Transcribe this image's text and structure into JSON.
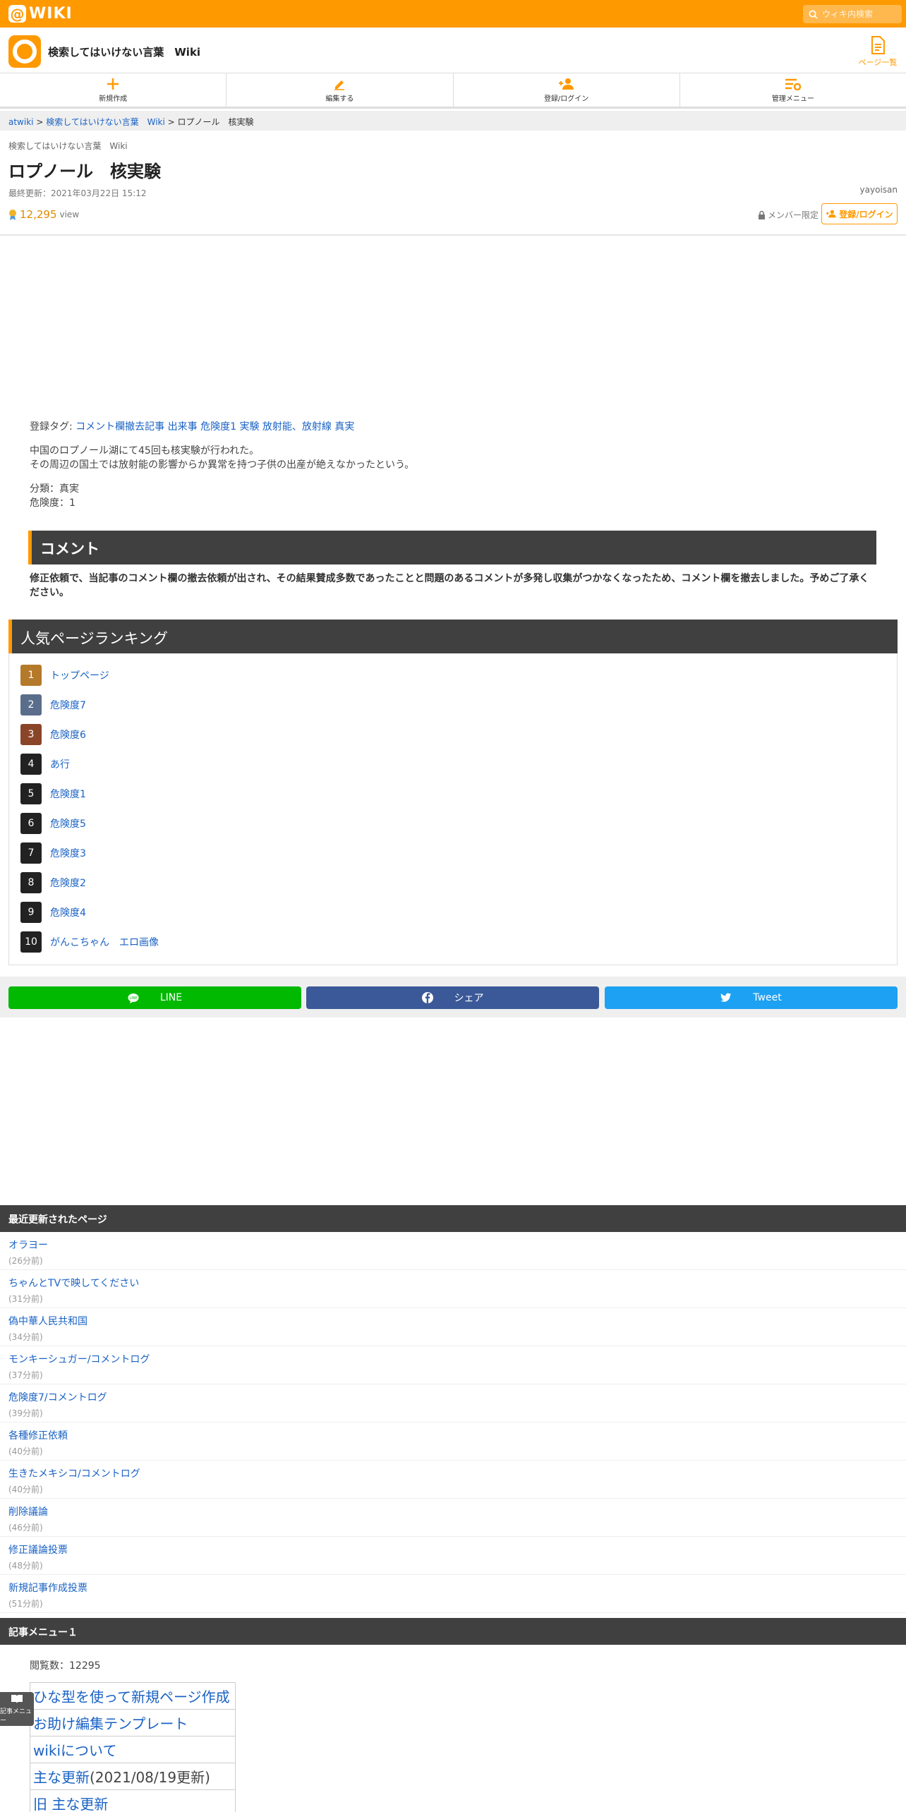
{
  "topbar": {
    "logo_text": "WIKI",
    "search_placeholder": "ウィキ内検索"
  },
  "site": {
    "title": "検索してはいけない言葉　Wiki",
    "page_list_label": "ページ一覧"
  },
  "nav": [
    {
      "label": "新規作成",
      "icon": "plus-icon"
    },
    {
      "label": "編集する",
      "icon": "pencil-icon"
    },
    {
      "label": "登録/ログイン",
      "icon": "add-user-icon"
    },
    {
      "label": "管理メニュー",
      "icon": "settings-list-icon"
    }
  ],
  "breadcrumb": {
    "home": "atwiki",
    "sep1": " > ",
    "wiki": "検索してはいけない言葉　Wiki",
    "sep2": " > ",
    "current": "ロプノール　核実験"
  },
  "page": {
    "subtitle": "検索してはいけない言葉　Wiki",
    "title": "ロプノール　核実験",
    "updated": "最終更新：2021年03月22日 15:12",
    "author": "yayoisan",
    "views_value": "12,295",
    "views_unit": "view",
    "member_only": "メンバー限定",
    "login_button": "登録/ログイン"
  },
  "content": {
    "tags_label": "登録タグ:",
    "tags": [
      "コメント欄撤去記事",
      "出来事",
      "危険度1",
      "実験",
      "放射能、放射線",
      "真実"
    ],
    "body_line1": "中国のロプノール湖にて45回も核実験が行われた。",
    "body_line2": "その周辺の国土では放射能の影響からか異常を持つ子供の出産が絶えなかったという。",
    "class_line": "分類：真実",
    "danger_line": "危険度：1",
    "comment_heading": "コメント",
    "comment_note": "修正依頼で、当記事のコメント欄の撤去依頼が出され、その結果賛成多数であったことと問題のあるコメントが多発し収集がつかなくなったため、コメント欄を撤去しました。予めご了承ください。"
  },
  "ranking": {
    "heading": "人気ページランキング",
    "items": [
      {
        "rank": "1",
        "title": "トップページ",
        "color": "#b5792a"
      },
      {
        "rank": "2",
        "title": "危険度7",
        "color": "#5a6e8c"
      },
      {
        "rank": "3",
        "title": "危険度6",
        "color": "#8a4528"
      },
      {
        "rank": "4",
        "title": "あ行",
        "color": "#222222"
      },
      {
        "rank": "5",
        "title": "危険度1",
        "color": "#222222"
      },
      {
        "rank": "6",
        "title": "危険度5",
        "color": "#222222"
      },
      {
        "rank": "7",
        "title": "危険度3",
        "color": "#222222"
      },
      {
        "rank": "8",
        "title": "危険度2",
        "color": "#222222"
      },
      {
        "rank": "9",
        "title": "危険度4",
        "color": "#222222"
      },
      {
        "rank": "10",
        "title": "がんこちゃん　エロ画像",
        "color": "#222222"
      }
    ]
  },
  "share": {
    "line": "LINE",
    "facebook": "シェア",
    "twitter": "Tweet"
  },
  "recent": {
    "heading": "最近更新されたページ",
    "items": [
      {
        "title": "オラヨー",
        "ago": "(26分前)"
      },
      {
        "title": "ちゃんとTVで映してください",
        "ago": "(31分前)"
      },
      {
        "title": "偽中華人民共和国",
        "ago": "(34分前)"
      },
      {
        "title": "モンキーシュガー/コメントログ",
        "ago": "(37分前)"
      },
      {
        "title": "危険度7/コメントログ",
        "ago": "(39分前)"
      },
      {
        "title": "各種修正依頼",
        "ago": "(40分前)"
      },
      {
        "title": "生きたメキシコ/コメントログ",
        "ago": "(40分前)"
      },
      {
        "title": "削除議論",
        "ago": "(46分前)"
      },
      {
        "title": "修正議論投票",
        "ago": "(48分前)"
      },
      {
        "title": "新規記事作成投票",
        "ago": "(51分前)"
      }
    ]
  },
  "menu1": {
    "heading": "記事メニュー１",
    "view_count": "閲覧数：12295",
    "items": [
      {
        "link": "ひな型を使って新規ページ作成",
        "suffix": ""
      },
      {
        "link": "お助け編集テンプレート",
        "suffix": ""
      },
      {
        "link": "wikiについて",
        "suffix": ""
      },
      {
        "link": "主な更新",
        "suffix": "(2021/08/19更新)"
      },
      {
        "link": "旧 主な更新",
        "suffix": ""
      }
    ]
  },
  "float_menu": {
    "label": "記事メニュー"
  },
  "colors": {
    "brand": "#ff9900",
    "dark_header": "#404040",
    "link": "#1a62c4",
    "line": "#00b900",
    "facebook": "#3b5998",
    "twitter": "#1da1f2"
  }
}
